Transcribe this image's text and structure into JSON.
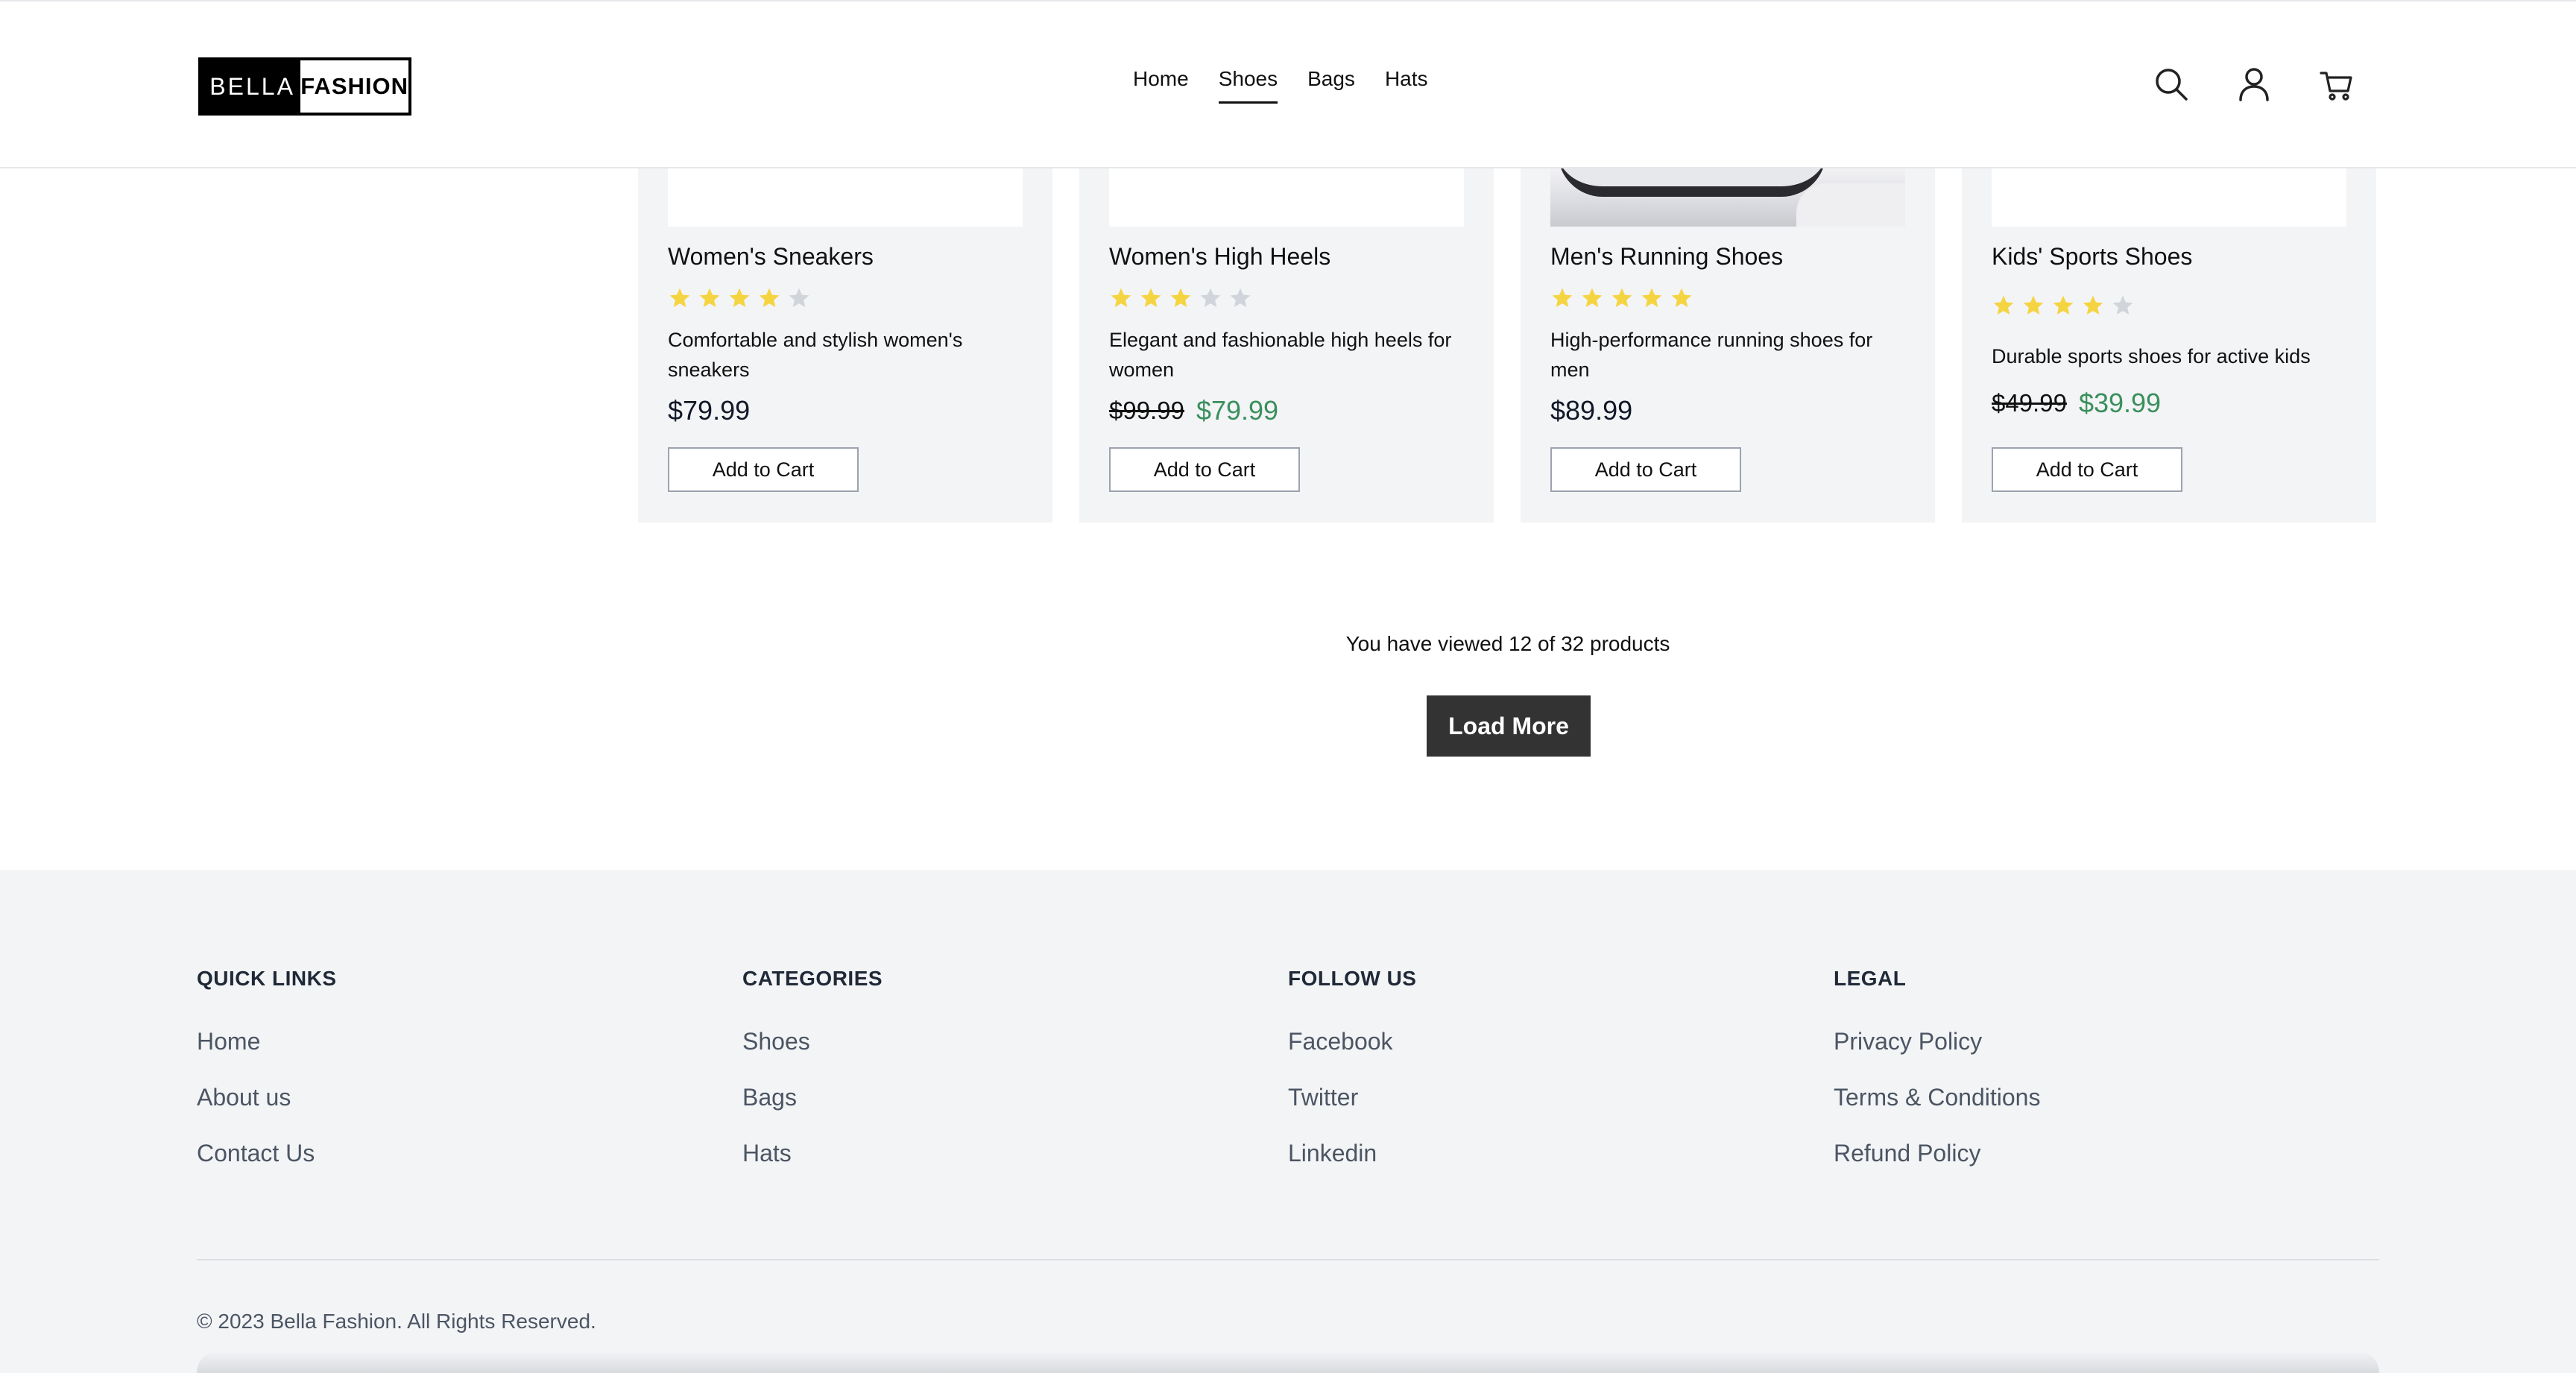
{
  "header": {
    "logo": {
      "left_text": "BELLA",
      "right_text": "FASHION"
    },
    "nav": [
      {
        "label": "Home",
        "active": false
      },
      {
        "label": "Shoes",
        "active": true
      },
      {
        "label": "Bags",
        "active": false
      },
      {
        "label": "Hats",
        "active": false
      }
    ],
    "icons": [
      "search-icon",
      "user-icon",
      "cart-icon"
    ]
  },
  "products": [
    {
      "name": "Women's Sneakers",
      "rating": 4,
      "description": "Comfortable and stylish women's sneakers",
      "price": "$79.99",
      "old_price": "",
      "button": "Add to Cart"
    },
    {
      "name": "Women's High Heels",
      "rating": 3,
      "description": "Elegant and fashionable high heels for women",
      "price": "$79.99",
      "old_price": "$99.99",
      "button": "Add to Cart"
    },
    {
      "name": "Men's Running Shoes",
      "rating": 5,
      "description": "High-performance running shoes for men",
      "price": "$89.99",
      "old_price": "",
      "button": "Add to Cart"
    },
    {
      "name": "Kids' Sports Shoes",
      "rating": 4,
      "description": "Durable sports shoes for active kids",
      "price": "$39.99",
      "old_price": "$49.99",
      "button": "Add to Cart"
    }
  ],
  "pagination": {
    "viewed_text": "You have viewed 12 of 32 products",
    "load_more": "Load More"
  },
  "footer": {
    "columns": [
      {
        "title": "QUICK LINKS",
        "links": [
          "Home",
          "About us",
          "Contact Us"
        ]
      },
      {
        "title": "CATEGORIES",
        "links": [
          "Shoes",
          "Bags",
          "Hats"
        ]
      },
      {
        "title": "FOLLOW US",
        "links": [
          "Facebook",
          "Twitter",
          "Linkedin"
        ]
      },
      {
        "title": "LEGAL",
        "links": [
          "Privacy Policy",
          "Terms & Conditions",
          "Refund Policy"
        ]
      }
    ],
    "copyright": "© 2023 Bella Fashion. All Rights Reserved."
  },
  "colors": {
    "star_filled": "#f5d442",
    "star_empty": "#d1d5db",
    "sale_price": "#3a8f5c",
    "button_dark": "#333333",
    "card_bg": "#f3f4f6"
  }
}
